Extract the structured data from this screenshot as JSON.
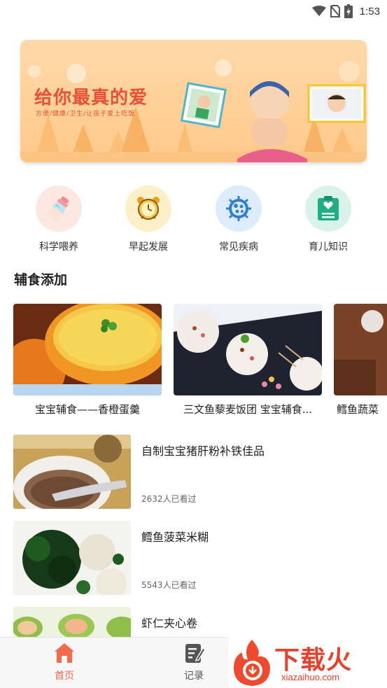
{
  "status_bar": {
    "time": "1:53",
    "icons": [
      "wifi-icon",
      "no-sim-icon",
      "battery-charging-icon"
    ]
  },
  "banner": {
    "title": "给你最真的爱",
    "subtitle": "方便/健康/卫生/让孩子爱上吃饭"
  },
  "categories": [
    {
      "label": "科学喂养",
      "icon": "baby-bottle-icon",
      "bg": "#fde7e1"
    },
    {
      "label": "早起发展",
      "icon": "alarm-clock-icon",
      "bg": "#fdf0c8"
    },
    {
      "label": "常见疾病",
      "icon": "virus-icon",
      "bg": "#dcecfb"
    },
    {
      "label": "育儿知识",
      "icon": "clipboard-heart-icon",
      "bg": "#daf3ea"
    }
  ],
  "section": {
    "title": "辅食添加"
  },
  "featured": [
    {
      "title": "宝宝辅食——香橙蛋羹"
    },
    {
      "title": "三文鱼藜麦饭团 宝宝辅食..."
    },
    {
      "title": "鳕鱼蔬菜"
    }
  ],
  "articles": [
    {
      "title": "自制宝宝猪肝粉补铁佳品",
      "views": "2632人已看过"
    },
    {
      "title": "鳕鱼菠菜米糊",
      "views": "5543人已看过"
    },
    {
      "title": "虾仁夹心卷",
      "views": ""
    }
  ],
  "tabbar": {
    "tabs": [
      {
        "label": "首页",
        "icon": "home-icon",
        "active": true
      },
      {
        "label": "记录",
        "icon": "edit-note-icon",
        "active": false
      }
    ],
    "active_color": "#f36b4c"
  },
  "watermark": {
    "text": "下载火",
    "url_text": "xiazaihuo.com"
  }
}
